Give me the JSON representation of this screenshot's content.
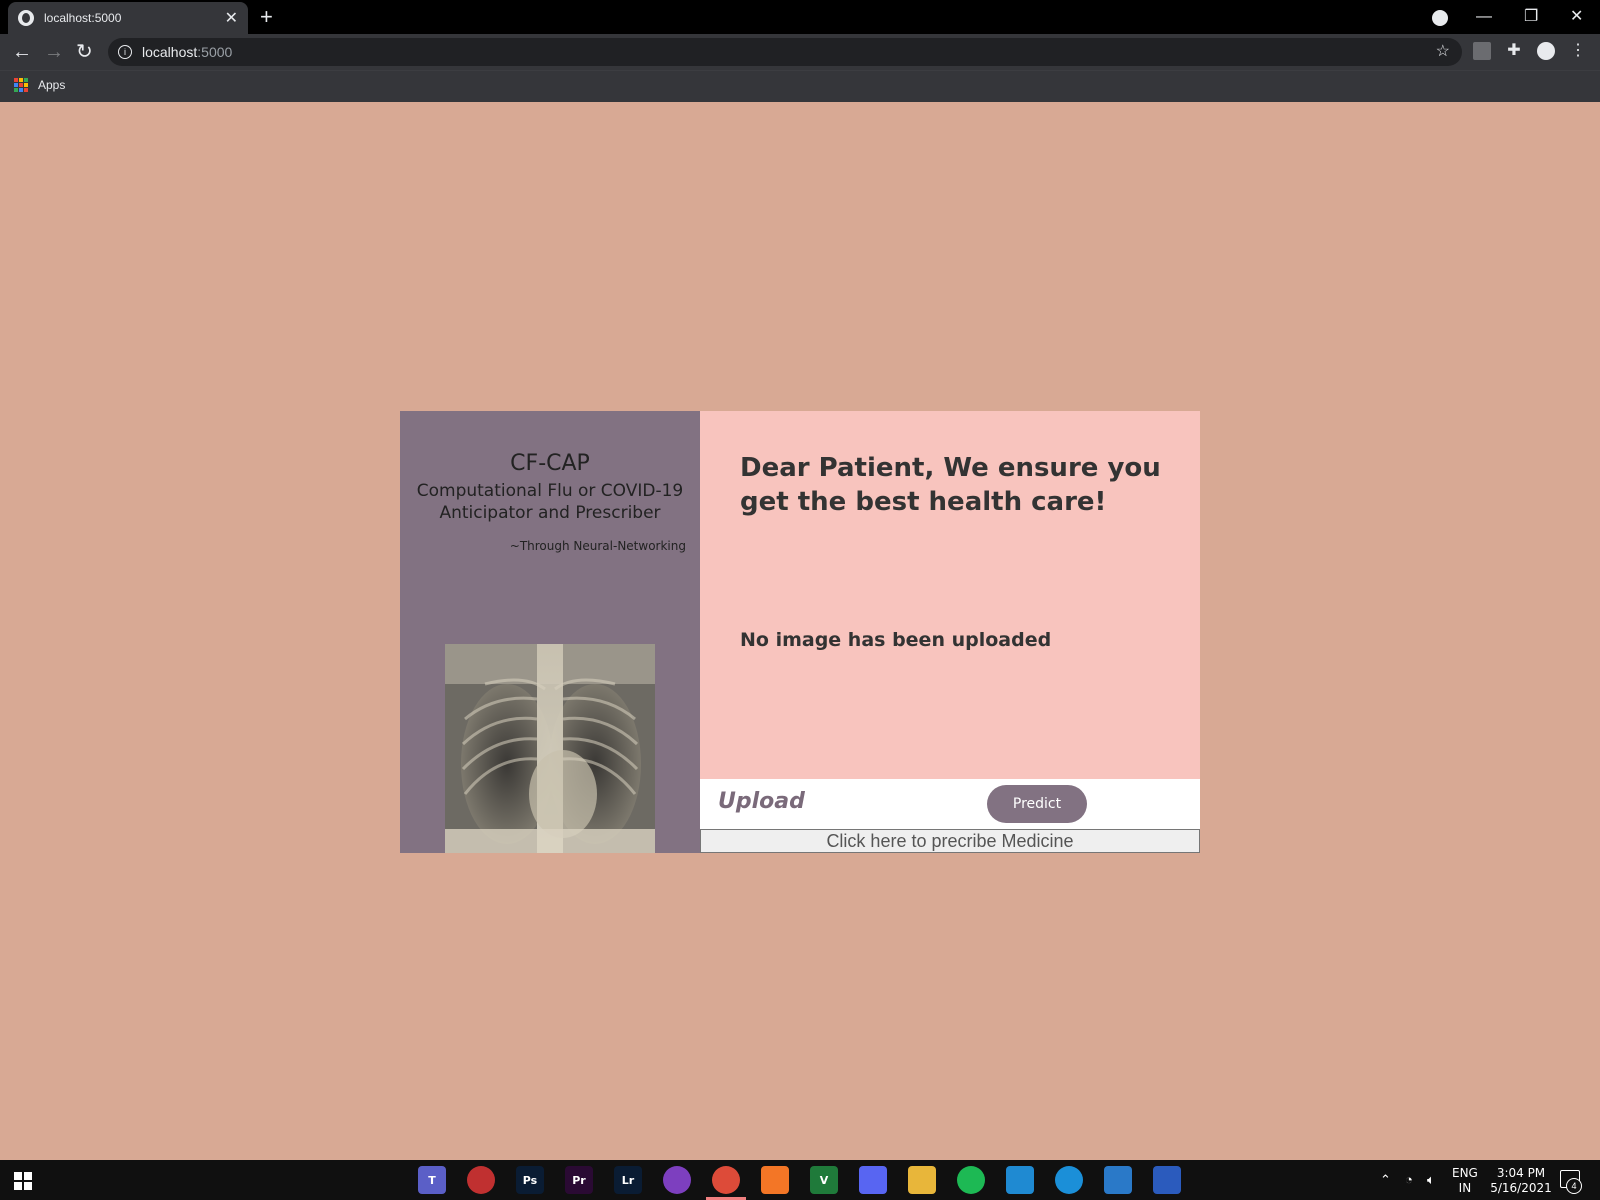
{
  "browser": {
    "tab_title": "localhost:5000",
    "new_tab": "+",
    "url_host": "localhost",
    "url_port": ":5000",
    "bookmarks": [
      {
        "label": "Apps"
      }
    ]
  },
  "brand": {
    "title": "CF-CAP",
    "subtitle_line1": "Computational Flu or COVID-19",
    "subtitle_line2": "Anticipator and Prescriber",
    "tagline": "~Through Neural-Networking"
  },
  "main": {
    "headline": "Dear Patient, We ensure you get the best health care!",
    "status": "No image has been uploaded"
  },
  "actions": {
    "upload_label": "Upload",
    "predict_label": "Predict",
    "prescribe_label": "Click here to precribe Medicine"
  },
  "taskbar": {
    "apps": [
      {
        "name": "teams-icon",
        "glyph": "T",
        "color": "#5b5fc7"
      },
      {
        "name": "app-red-icon",
        "glyph": "",
        "color": "#c03030"
      },
      {
        "name": "photoshop-icon",
        "glyph": "Ps",
        "color": "#0a1c33"
      },
      {
        "name": "premiere-icon",
        "glyph": "Pr",
        "color": "#2a0a33"
      },
      {
        "name": "lightroom-icon",
        "glyph": "Lr",
        "color": "#0a1c33"
      },
      {
        "name": "tor-icon",
        "glyph": "",
        "color": "#7d3fbf"
      },
      {
        "name": "chrome-icon",
        "glyph": "",
        "color": "#dd4b39"
      },
      {
        "name": "jupyter-icon",
        "glyph": "",
        "color": "#f37626"
      },
      {
        "name": "vim-icon",
        "glyph": "V",
        "color": "#1f7a3a"
      },
      {
        "name": "discord-icon",
        "glyph": "",
        "color": "#5865f2"
      },
      {
        "name": "file-explorer-icon",
        "glyph": "",
        "color": "#e8b63a"
      },
      {
        "name": "spotify-icon",
        "glyph": "",
        "color": "#1db954"
      },
      {
        "name": "vscode-icon",
        "glyph": "",
        "color": "#1f8ad2"
      },
      {
        "name": "edge-icon",
        "glyph": "",
        "color": "#1b8fd8"
      },
      {
        "name": "media-player-icon",
        "glyph": "",
        "color": "#2a79c8"
      },
      {
        "name": "powershell-icon",
        "glyph": "",
        "color": "#2b5bbd"
      }
    ],
    "lang": "ENG",
    "region": "IN",
    "time": "3:04 PM",
    "date": "5/16/2021",
    "notifications": "4"
  },
  "colors": {
    "page_bg": "#d8a994",
    "left_panel": "#827282",
    "right_panel": "#f8c4be",
    "predict_button": "#827282"
  }
}
